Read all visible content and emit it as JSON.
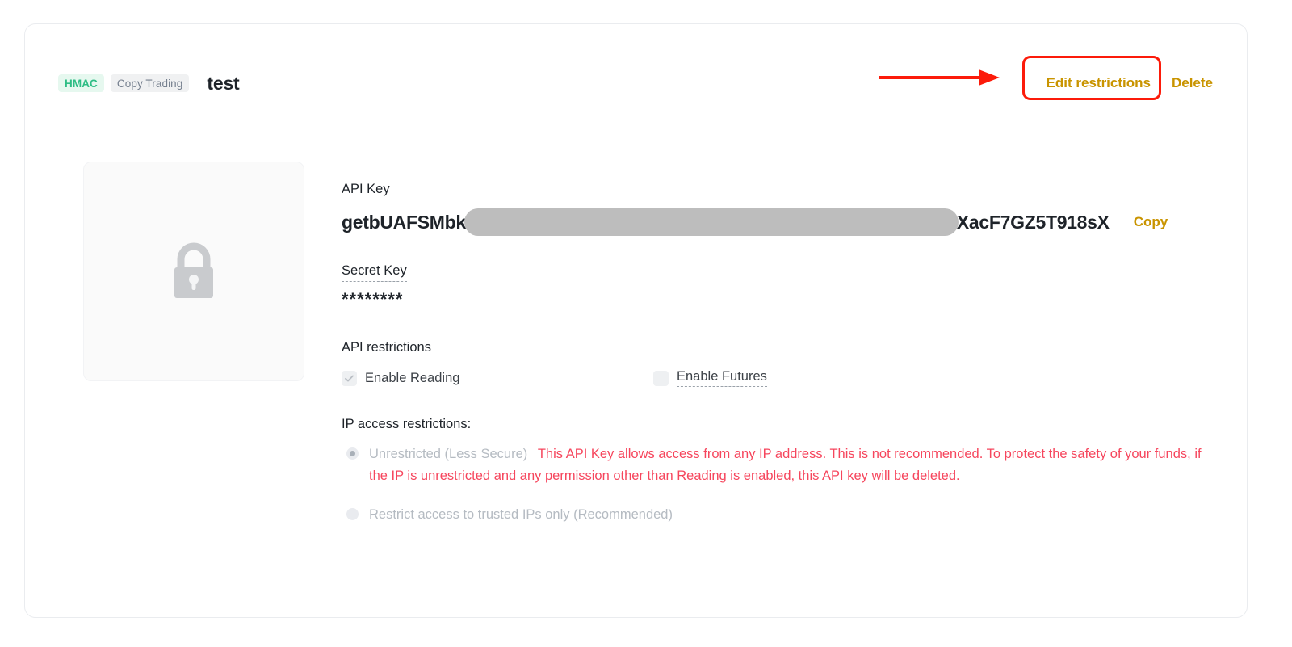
{
  "header": {
    "badges": [
      {
        "label": "HMAC",
        "kind": "hmac"
      },
      {
        "label": "Copy Trading",
        "kind": "copy-trading"
      }
    ],
    "key_name": "test",
    "edit_restrictions_label": "Edit restrictions",
    "delete_label": "Delete"
  },
  "annotation": {
    "color": "#fc1b0a",
    "target": "Edit restrictions"
  },
  "placeholder": {
    "icon": "lock-icon"
  },
  "api_key": {
    "label": "API Key",
    "value_prefix": "getbUAFSMbk",
    "value_redacted": true,
    "value_suffix": "XacF7GZ5T918sX",
    "copy_label": "Copy"
  },
  "secret_key": {
    "label": "Secret Key",
    "value": "********"
  },
  "api_restrictions": {
    "title": "API restrictions",
    "items": [
      {
        "label": "Enable Reading",
        "checked": true,
        "hinted": false
      },
      {
        "label": "Enable Futures",
        "checked": false,
        "hinted": true
      }
    ]
  },
  "ip_restrictions": {
    "title": "IP access restrictions:",
    "unrestricted_label": "Unrestricted (Less Secure)",
    "unrestricted_warning": "This API Key allows access from any IP address. This is not recommended.",
    "selected_warning": "To protect the safety of your funds, if the IP is unrestricted and any permission other than Reading is enabled, this API key will be deleted.",
    "restricted_label": "Restrict access to trusted IPs only (Recommended)",
    "selected": "unrestricted"
  },
  "colors": {
    "accent_gold": "#c99400",
    "badge_green": "#2ebd85",
    "danger_red": "#f6465d",
    "annotation_red": "#fc1b0a"
  }
}
